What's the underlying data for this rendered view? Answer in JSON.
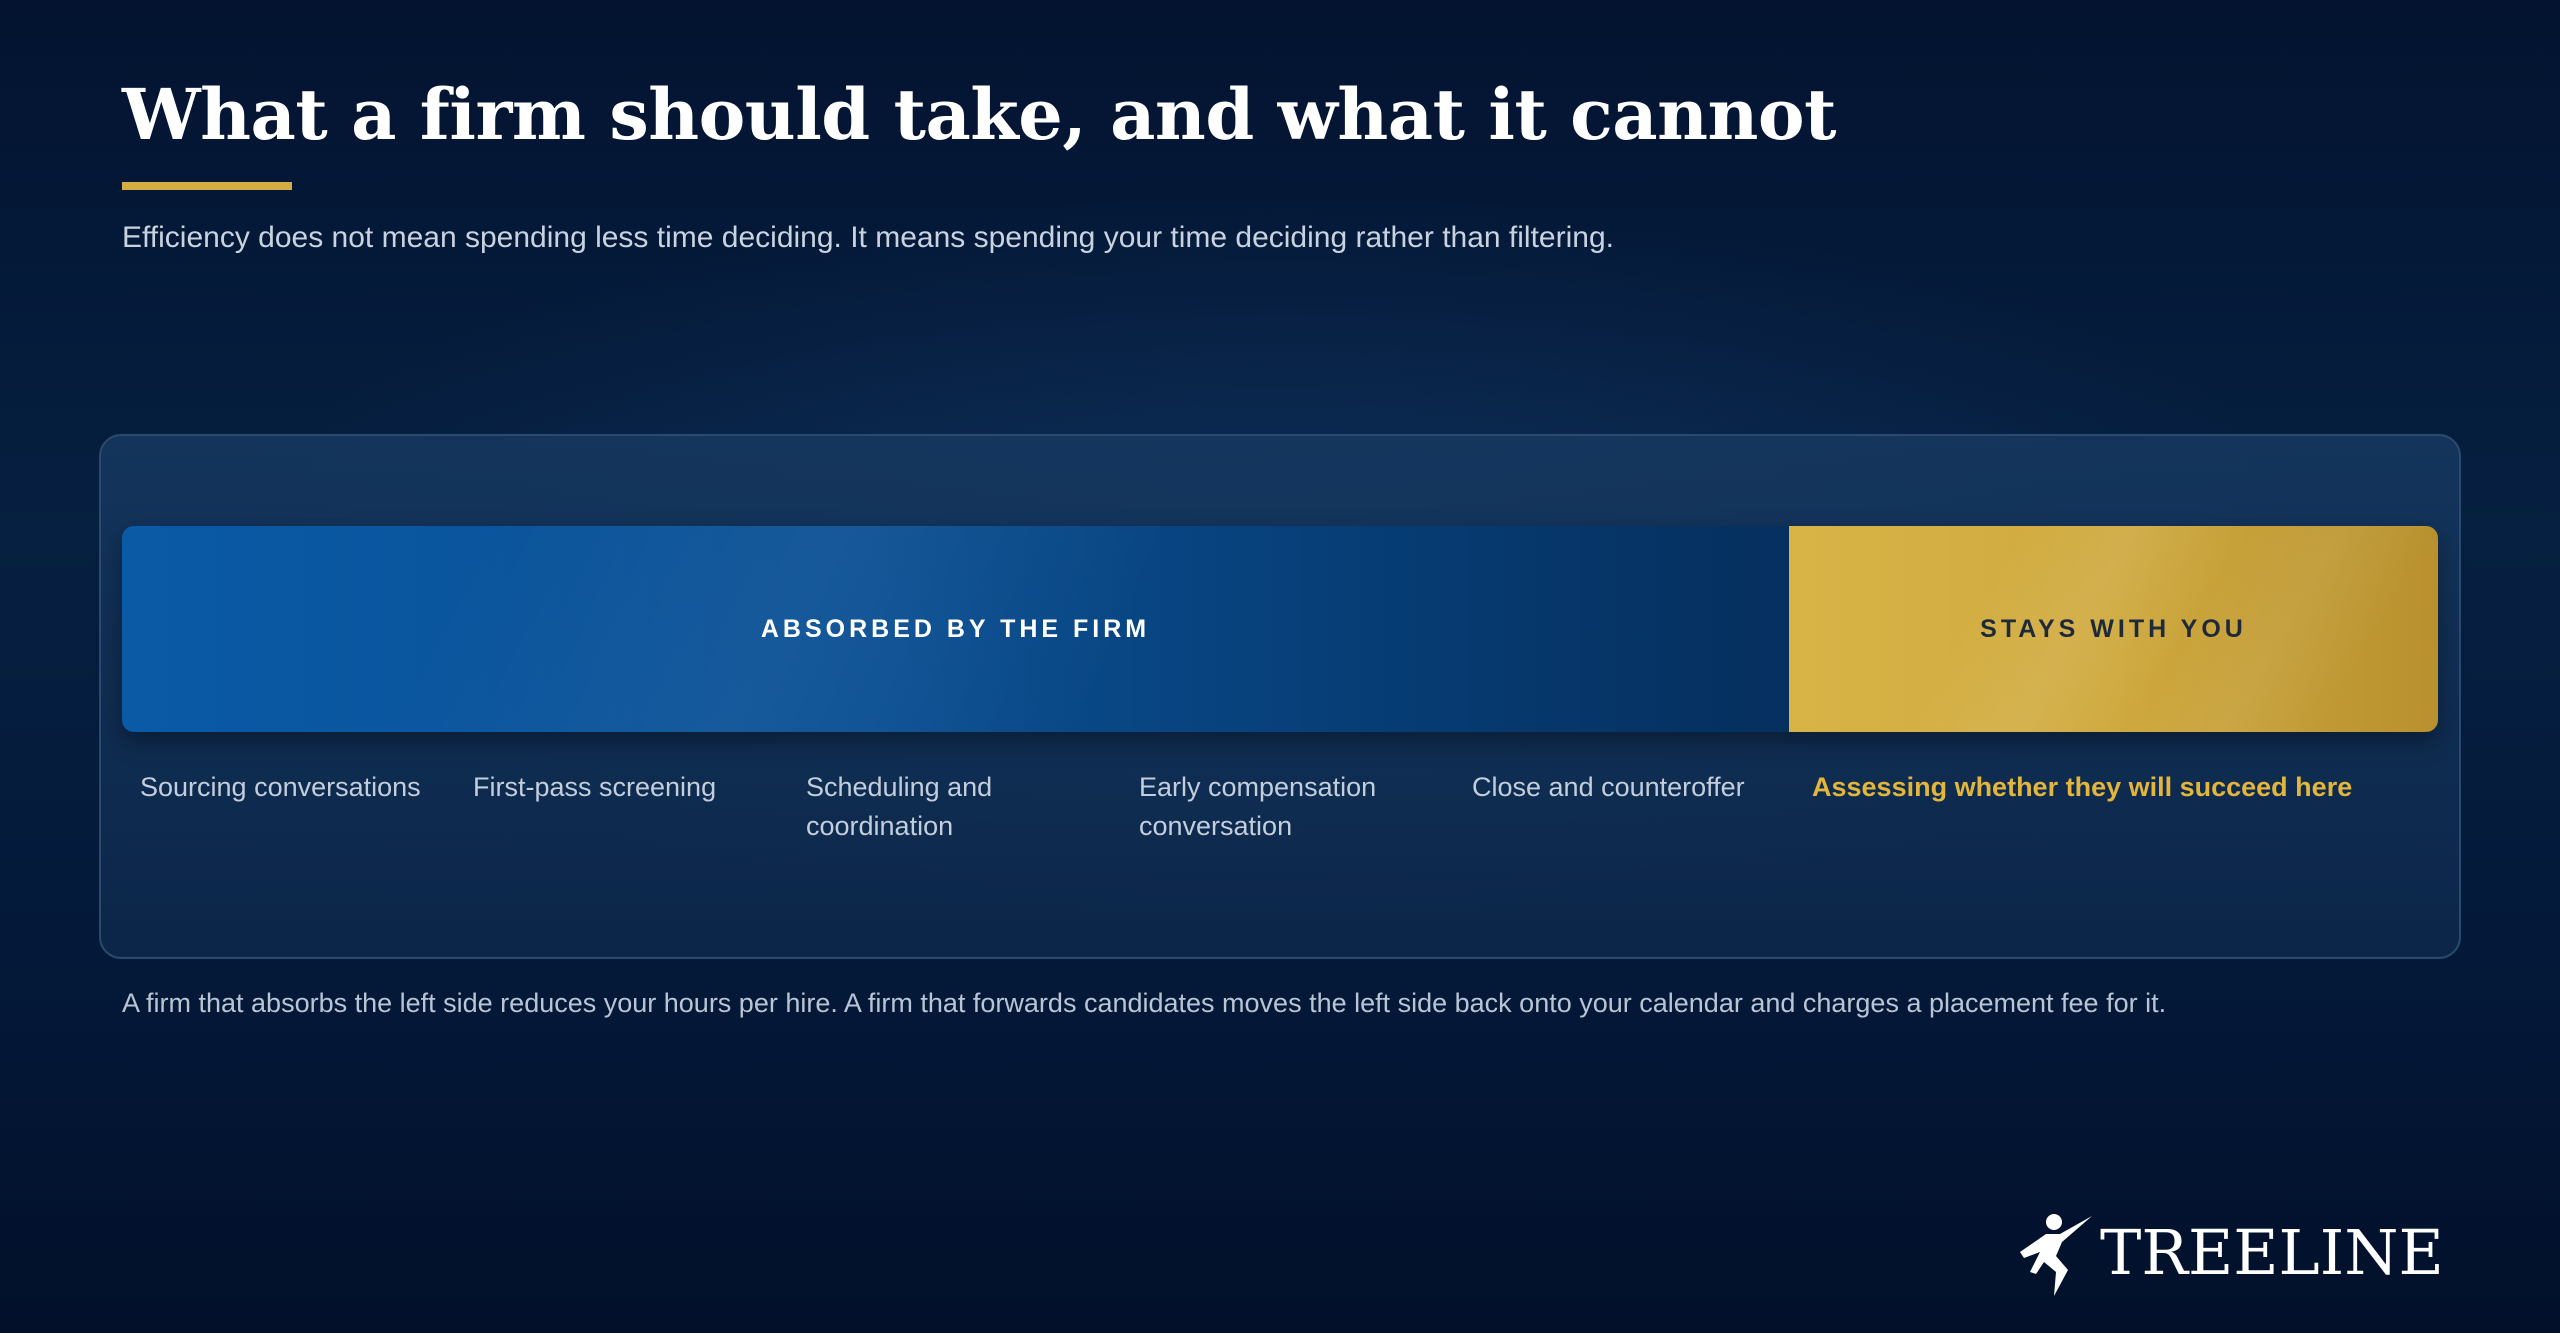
{
  "slide": {
    "title": "What a firm should take, and what it cannot",
    "subtitle": "Efficiency does not mean spending less time deciding. It means spending your time deciding rather than filtering."
  },
  "bar": {
    "firm_label": "ABSORBED BY THE FIRM",
    "you_label": "STAYS WITH YOU"
  },
  "tasks": [
    "Sourcing conversations",
    "First-pass screening",
    "Scheduling and coordination",
    "Early compensation conversation",
    "Close and counteroffer",
    "Assessing whether they will succeed here"
  ],
  "footnote": "A firm that absorbs the left side reduces your hours per hire. A firm that forwards candidates moves the left side back onto your calendar and charges a placement fee for it.",
  "brand": {
    "name": "TREELINE",
    "logo_icon": "running-figure-icon"
  },
  "colors": {
    "accent_gold": "#d4ae45",
    "firm_blue": "#0a5aa6",
    "background_navy": "#04193a"
  }
}
